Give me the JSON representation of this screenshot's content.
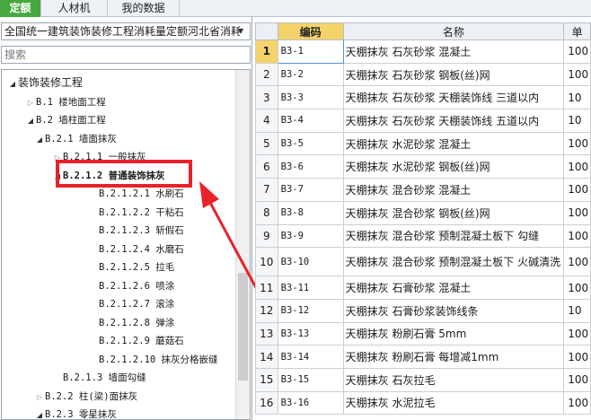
{
  "tabs": [
    {
      "label": "定额",
      "active": true
    },
    {
      "label": "人材机",
      "active": false
    },
    {
      "label": "我的数据",
      "active": false
    }
  ],
  "left": {
    "dropdown_value": "全国统一建筑装饰装修工程消耗量定额河北省消耗",
    "search_placeholder": "搜索",
    "tree": [
      {
        "label": "装饰装修工程",
        "level": 0,
        "state": "open"
      },
      {
        "label": "B.1 楼地面工程",
        "level": 1,
        "state": "closed"
      },
      {
        "label": "B.2 墙柱面工程",
        "level": 1,
        "state": "open"
      },
      {
        "label": "B.2.1 墙面抹灰",
        "level": 2,
        "state": "open"
      },
      {
        "label": "B.2.1.1 一般抹灰",
        "level": 3,
        "state": "closed"
      },
      {
        "label": "B.2.1.2 普通装饰抹灰",
        "level": 3,
        "state": "open",
        "highlighted": true
      },
      {
        "label": "B.2.1.2.1 水刷石",
        "level": 4,
        "state": "leaf"
      },
      {
        "label": "B.2.1.2.2 干粘石",
        "level": 4,
        "state": "leaf"
      },
      {
        "label": "B.2.1.2.3 斩假石",
        "level": 4,
        "state": "leaf"
      },
      {
        "label": "B.2.1.2.4 水磨石",
        "level": 4,
        "state": "leaf"
      },
      {
        "label": "B.2.1.2.5 拉毛",
        "level": 4,
        "state": "leaf"
      },
      {
        "label": "B.2.1.2.6 喷涂",
        "level": 4,
        "state": "leaf"
      },
      {
        "label": "B.2.1.2.7 滚涂",
        "level": 4,
        "state": "leaf"
      },
      {
        "label": "B.2.1.2.8 弹涂",
        "level": 4,
        "state": "leaf"
      },
      {
        "label": "B.2.1.2.9 蘑菇石",
        "level": 4,
        "state": "leaf"
      },
      {
        "label": "B.2.1.2.10 抹灰分格嵌缝",
        "level": 4,
        "state": "leaf"
      },
      {
        "label": "B.2.1.3 墙面勾缝",
        "level": 3,
        "state": "leaf"
      },
      {
        "label": "B.2.2 柱(梁)面抹灰",
        "level": 2,
        "state": "closed"
      },
      {
        "label": "B.2.3 零星抹灰",
        "level": 2,
        "state": "open"
      }
    ]
  },
  "table": {
    "headers": {
      "idx": "",
      "code": "编码",
      "name": "名称",
      "unit": "单"
    },
    "rows": [
      {
        "idx": "1",
        "code": "B3-1",
        "name": "天棚抹灰 石灰砂浆 混凝土",
        "unit": "100"
      },
      {
        "idx": "2",
        "code": "B3-2",
        "name": "天棚抹灰 石灰砂浆 钢板(丝)网",
        "unit": "100"
      },
      {
        "idx": "3",
        "code": "B3-3",
        "name": "天棚抹灰 石灰砂浆 天棚装饰线 三道以内",
        "unit": "10"
      },
      {
        "idx": "4",
        "code": "B3-4",
        "name": "天棚抹灰 石灰砂浆 天棚装饰线 五道以内",
        "unit": "10"
      },
      {
        "idx": "5",
        "code": "B3-5",
        "name": "天棚抹灰 水泥砂浆 混凝土",
        "unit": "100"
      },
      {
        "idx": "6",
        "code": "B3-6",
        "name": "天棚抹灰 水泥砂浆 钢板(丝)网",
        "unit": "100"
      },
      {
        "idx": "7",
        "code": "B3-7",
        "name": "天棚抹灰 混合砂浆 混凝土",
        "unit": "100"
      },
      {
        "idx": "8",
        "code": "B3-8",
        "name": "天棚抹灰 混合砂浆 钢板(丝)网",
        "unit": "100"
      },
      {
        "idx": "9",
        "code": "B3-9",
        "name": "天棚抹灰 混合砂浆 预制混凝土板下 勾缝",
        "unit": "100"
      },
      {
        "idx": "10",
        "code": "B3-10",
        "name": "天棚抹灰 混合砂浆 预制混凝土板下 火碱清洗",
        "unit": "100"
      },
      {
        "idx": "11",
        "code": "B3-11",
        "name": "天棚抹灰 石膏砂浆 混凝土",
        "unit": "100"
      },
      {
        "idx": "12",
        "code": "B3-12",
        "name": "天棚抹灰 石膏砂浆装饰线条",
        "unit": "10"
      },
      {
        "idx": "13",
        "code": "B3-13",
        "name": "天棚抹灰 粉刷石膏 5mm",
        "unit": "100"
      },
      {
        "idx": "14",
        "code": "B3-14",
        "name": "天棚抹灰 粉刷石膏 每增减1mm",
        "unit": "100"
      },
      {
        "idx": "15",
        "code": "B3-15",
        "name": "天棚抹灰 石灰拉毛",
        "unit": "100"
      },
      {
        "idx": "16",
        "code": "B3-16",
        "name": "天棚抹灰 水泥拉毛",
        "unit": "100"
      }
    ]
  },
  "colors": {
    "tab_active": "#46a83e",
    "highlight": "#e8222a",
    "selected": "#f3d36a"
  }
}
